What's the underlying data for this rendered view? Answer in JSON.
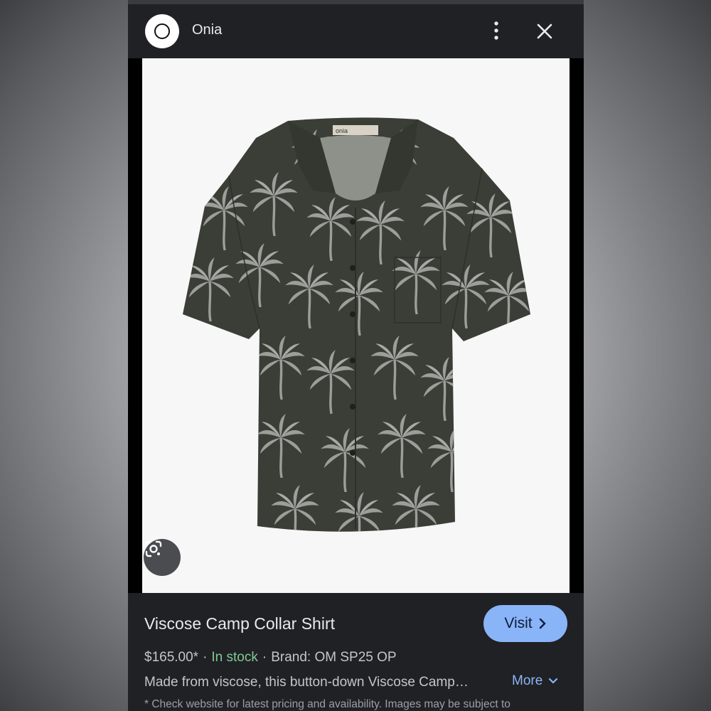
{
  "header": {
    "site_name": "Onia",
    "logo_icon": "onia-logo-icon",
    "menu_icon": "more-vert-icon",
    "close_icon": "close-icon"
  },
  "image": {
    "tag_text": "onia",
    "lens_icon": "google-lens-icon"
  },
  "product": {
    "title": "Viscose Camp Collar Shirt",
    "visit_label": "Visit",
    "price": "$165.00*",
    "stock": "In stock",
    "brand": "Brand: OM SP25 OP",
    "description": "Made from viscose, this button-down Viscose Camp…",
    "more_label": "More",
    "disclaimer": "* Check website for latest pricing and availability. Images may be subject to"
  },
  "colors": {
    "panel_bg": "#202124",
    "accent": "#8ab4f8",
    "stock_green": "#81c995",
    "shirt": "#3b3e37",
    "palm": "#9c9e99"
  }
}
